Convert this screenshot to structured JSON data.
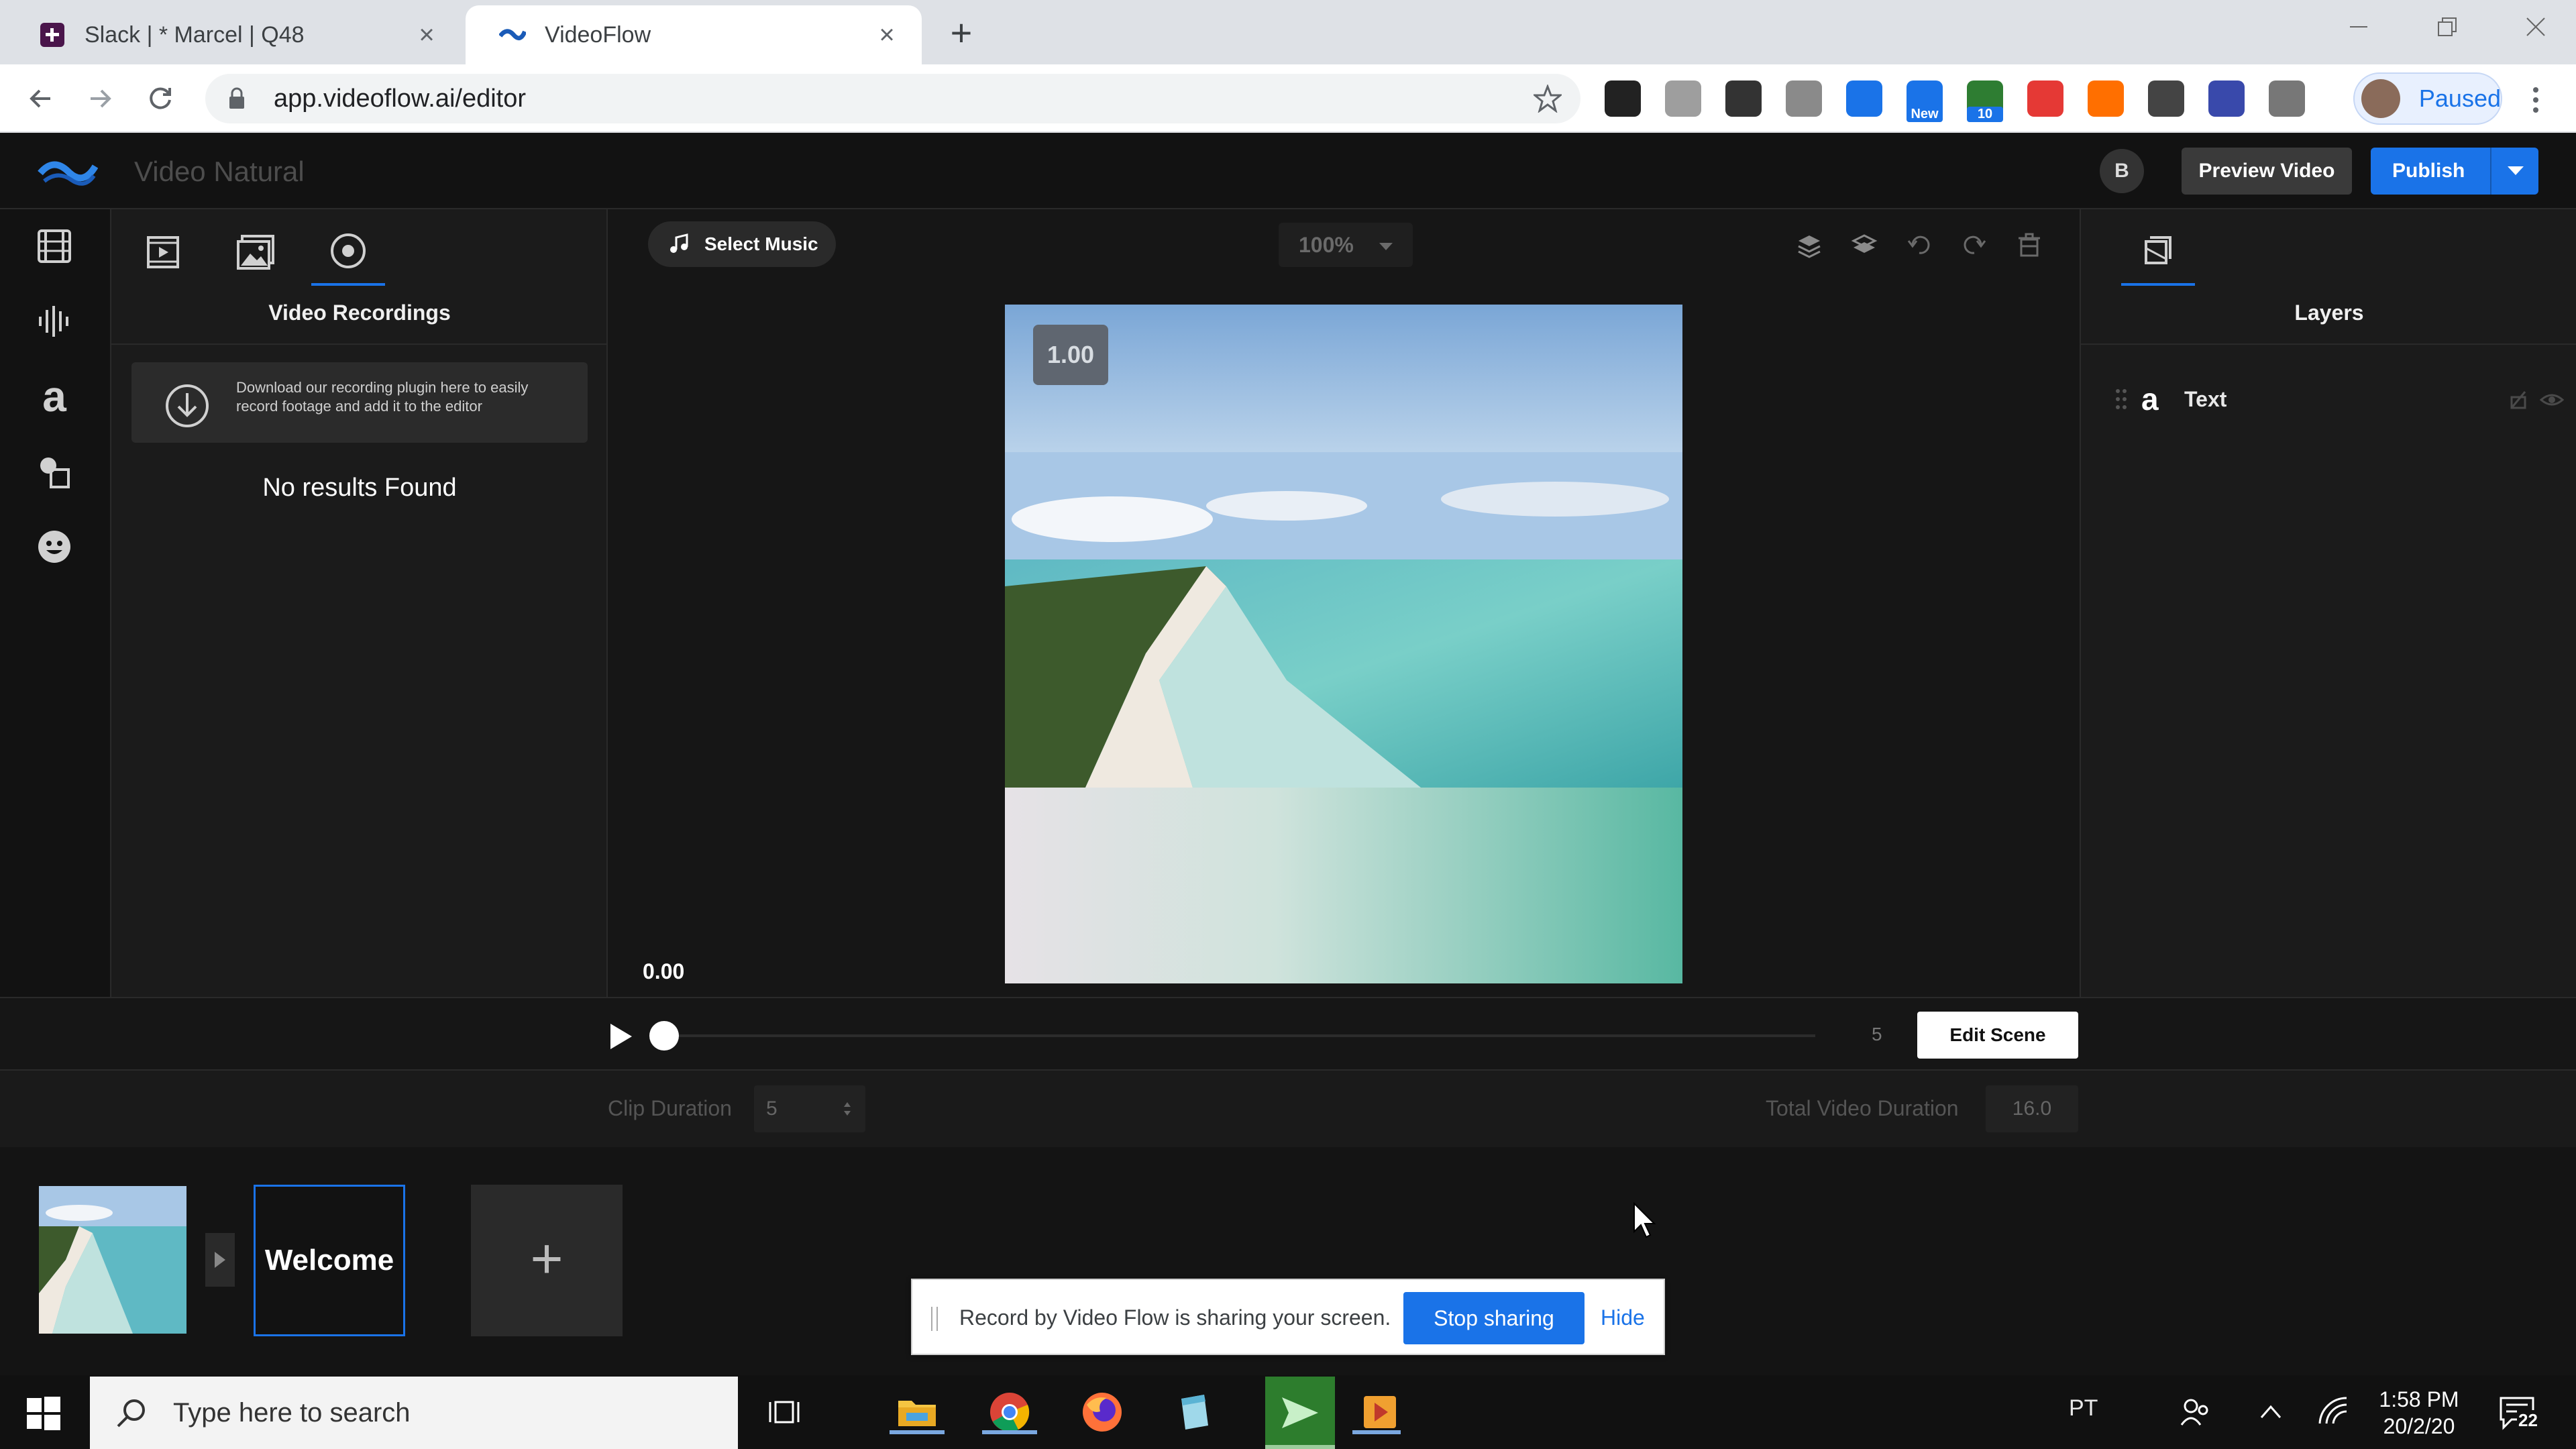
{
  "browser": {
    "tabs": [
      {
        "title": "Slack | * Marcel | Q48",
        "icon": "slack-icon",
        "active": false
      },
      {
        "title": "VideoFlow",
        "icon": "videoflow-icon",
        "active": true
      }
    ],
    "url": "app.videoflow.ai/editor",
    "profile_label": "Paused",
    "extensions": [
      {
        "icon": "chrome-ext-icon",
        "color": "#222222"
      },
      {
        "icon": "ext-gray-icon",
        "color": "#9e9e9e"
      },
      {
        "icon": "gmail-m-icon",
        "color": "#333333"
      },
      {
        "icon": "code-ext-icon",
        "color": "#8a8a8a"
      },
      {
        "icon": "outlook-ext-icon",
        "color": "#1a73e8"
      },
      {
        "icon": "new-ext-icon",
        "color": "#1a73e8",
        "badge": "New"
      },
      {
        "icon": "cast-ext-icon",
        "color": "#2e7d32",
        "badge": "10"
      },
      {
        "icon": "youtube-ext-icon",
        "color": "#e53935"
      },
      {
        "icon": "star-ext-icon",
        "color": "#ff6f00"
      },
      {
        "icon": "pin-ext-icon",
        "color": "#444444"
      },
      {
        "icon": "videoflow-ext-icon",
        "color": "#3949ab"
      },
      {
        "icon": "playlist-ext-icon",
        "color": "#777777"
      }
    ]
  },
  "app": {
    "project_title": "Video Natural",
    "avatar_letter": "B",
    "preview_label": "Preview Video",
    "publish_label": "Publish",
    "accent": "#1a73e8"
  },
  "left_rail": [
    "film-icon",
    "audio-bars-icon",
    "text-a-icon",
    "shapes-icon",
    "emoji-icon"
  ],
  "left_panel": {
    "tabs": [
      "scene-icon",
      "image-icon",
      "record-icon"
    ],
    "title": "Video Recordings",
    "download_text": "Download our recording plugin here to easily record footage and add it to the editor",
    "empty_text": "No results Found"
  },
  "canvas": {
    "select_music": "Select Music",
    "zoom": "100%",
    "scale_badge": "1.00",
    "current_time": "0.00"
  },
  "right_panel": {
    "title": "Layers",
    "layers": [
      {
        "name": "Text",
        "type_icon": "a"
      }
    ]
  },
  "playback": {
    "end_time": "5",
    "edit_scene": "Edit Scene",
    "progress": 0
  },
  "durations": {
    "clip_label": "Clip Duration",
    "clip_value": "5",
    "total_label": "Total Video Duration",
    "total_value": "16.0"
  },
  "scenes": {
    "items": [
      {
        "type": "image"
      },
      {
        "label": "Welcome"
      }
    ],
    "add_label": "+"
  },
  "share_banner": {
    "text": "Record by Video Flow is sharing your screen.",
    "stop_label": "Stop sharing",
    "hide_label": "Hide"
  },
  "taskbar": {
    "search_placeholder": "Type here to search",
    "language": "PT",
    "time": "1:58 PM",
    "date": "20/2/20",
    "notification_count": "22"
  }
}
